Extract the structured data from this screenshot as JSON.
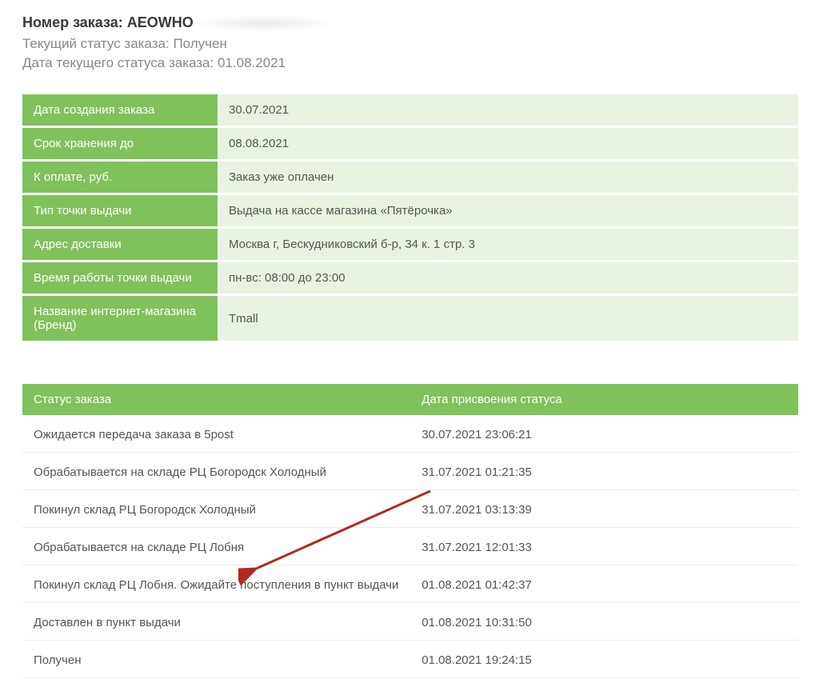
{
  "header": {
    "order_label": "Номер заказа:",
    "order_value": "AEOWHO",
    "status_label": "Текущий статус заказа:",
    "status_value": "Получен",
    "status_date_label": "Дата текущего статуса заказа:",
    "status_date_value": "01.08.2021"
  },
  "info_rows": [
    {
      "label": "Дата создания заказа",
      "value": "30.07.2021"
    },
    {
      "label": "Срок хранения до",
      "value": "08.08.2021"
    },
    {
      "label": "К оплате, руб.",
      "value": "Заказ уже оплачен"
    },
    {
      "label": "Тип точки выдачи",
      "value": "Выдача на кассе магазина «Пятёрочка»"
    },
    {
      "label": "Адрес доставки",
      "value": "Москва г, Бескудниковский б-р, 34 к. 1 стр. 3"
    },
    {
      "label": "Время работы точки выдачи",
      "value": "пн-вс: 08:00 до 23:00"
    },
    {
      "label": "Название интернет-магазина (Бренд)",
      "value": "Tmall"
    }
  ],
  "status_header": {
    "col1": "Статус заказа",
    "col2": "Дата присвоения статуса"
  },
  "status_rows": [
    {
      "status": "Ожидается передача заказа в 5post",
      "date": "30.07.2021 23:06:21"
    },
    {
      "status": "Обрабатывается на складе РЦ Богородск Холодный",
      "date": "31.07.2021 01:21:35"
    },
    {
      "status": "Покинул склад РЦ Богородск Холодный",
      "date": "31.07.2021 03:13:39"
    },
    {
      "status": "Обрабатывается на складе РЦ Лобня",
      "date": "31.07.2021 12:01:33"
    },
    {
      "status": "Покинул склад РЦ Лобня. Ожидайте поступления в пункт выдачи",
      "date": "01.08.2021 01:42:37"
    },
    {
      "status": "Доставлен в пункт выдачи",
      "date": "01.08.2021 10:31:50"
    },
    {
      "status": "Получен",
      "date": "01.08.2021 19:24:15"
    }
  ]
}
